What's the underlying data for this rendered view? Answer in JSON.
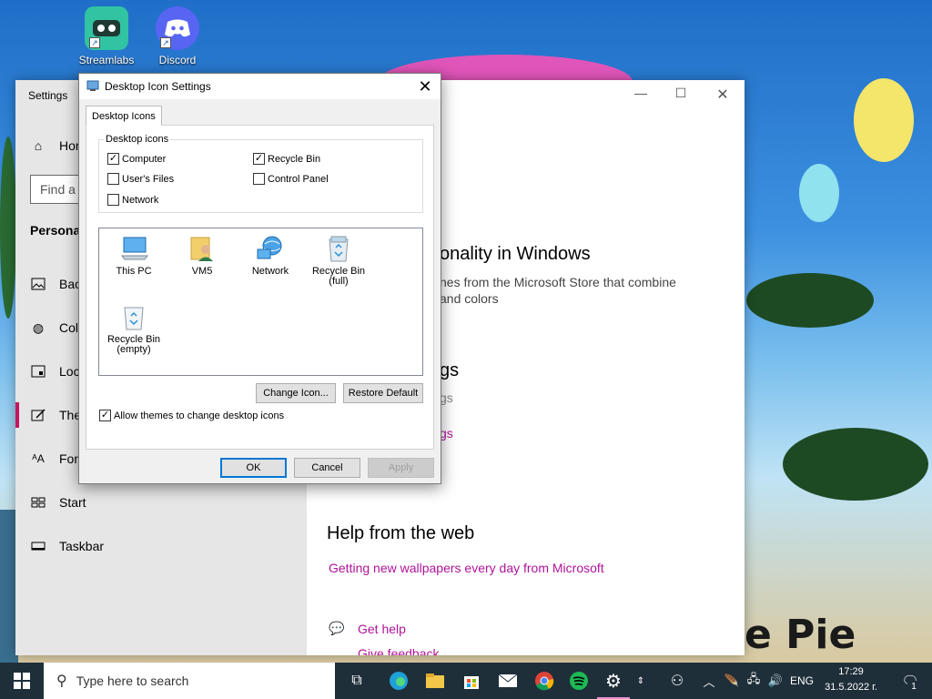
{
  "desktop_icons": [
    {
      "label": "Streamlabs OBS",
      "icon": "streamlabs-icon",
      "color": "#31c3a2"
    },
    {
      "label": "Discord",
      "icon": "discord-icon",
      "color": "#5865f2"
    }
  ],
  "wallpaper": {
    "visible_text": "e Pie"
  },
  "settings": {
    "title": "Settings",
    "search_placeholder": "Find a s",
    "home_label": "Hor",
    "section": "Personal",
    "side_items": [
      {
        "label": "Bac",
        "icon": "image-icon"
      },
      {
        "label": "Col",
        "icon": "palette-icon"
      },
      {
        "label": "Loc",
        "icon": "lock-screen-icon"
      },
      {
        "label": "The",
        "icon": "theme-icon"
      },
      {
        "label": "Fon",
        "icon": "font-icon"
      },
      {
        "label": "Start",
        "icon": "start-icon"
      },
      {
        "label": "Taskbar",
        "icon": "taskbar-icon"
      }
    ],
    "main": {
      "heading1": "onality in Windows",
      "desc1_line1": "nes from the Microsoft Store that combine",
      "desc1_line2": "and colors",
      "heading2": "gs",
      "desc2": "gs",
      "link1": "gs",
      "help_heading": "Help from the web",
      "help_link": "Getting new wallpapers every day from Microsoft",
      "get_help": "Get help",
      "feedback_partial": "Give feedback"
    }
  },
  "dialog": {
    "title": "Desktop Icon Settings",
    "tab_label": "Desktop Icons",
    "group_label": "Desktop icons",
    "checkboxes": [
      {
        "label": "Computer",
        "checked": true
      },
      {
        "label": "Recycle Bin",
        "checked": true
      },
      {
        "label": "User's Files",
        "checked": false
      },
      {
        "label": "Control Panel",
        "checked": false
      },
      {
        "label": "Network",
        "checked": false
      }
    ],
    "icons": [
      {
        "label_line1": "This PC",
        "label_line2": "",
        "icon": "this-pc-icon"
      },
      {
        "label_line1": "VM5",
        "label_line2": "",
        "icon": "user-folder-icon"
      },
      {
        "label_line1": "Network",
        "label_line2": "",
        "icon": "network-icon"
      },
      {
        "label_line1": "Recycle Bin",
        "label_line2": "(full)",
        "icon": "recycle-bin-full-icon"
      },
      {
        "label_line1": "Recycle Bin",
        "label_line2": "(empty)",
        "icon": "recycle-bin-empty-icon"
      }
    ],
    "change_icon": "Change Icon...",
    "restore_default": "Restore Default",
    "allow_themes": {
      "label": "Allow themes to change desktop icons",
      "checked": true
    },
    "ok": "OK",
    "cancel": "Cancel",
    "apply": "Apply"
  },
  "taskbar": {
    "search_placeholder": "Type here to search",
    "time": "17:29",
    "date": "31.5.2022 г.",
    "language": "ENG",
    "notification_count": "1"
  },
  "colors": {
    "accent": "#0078d7",
    "link": "#b0139a",
    "settings_active": "#c2185b"
  }
}
